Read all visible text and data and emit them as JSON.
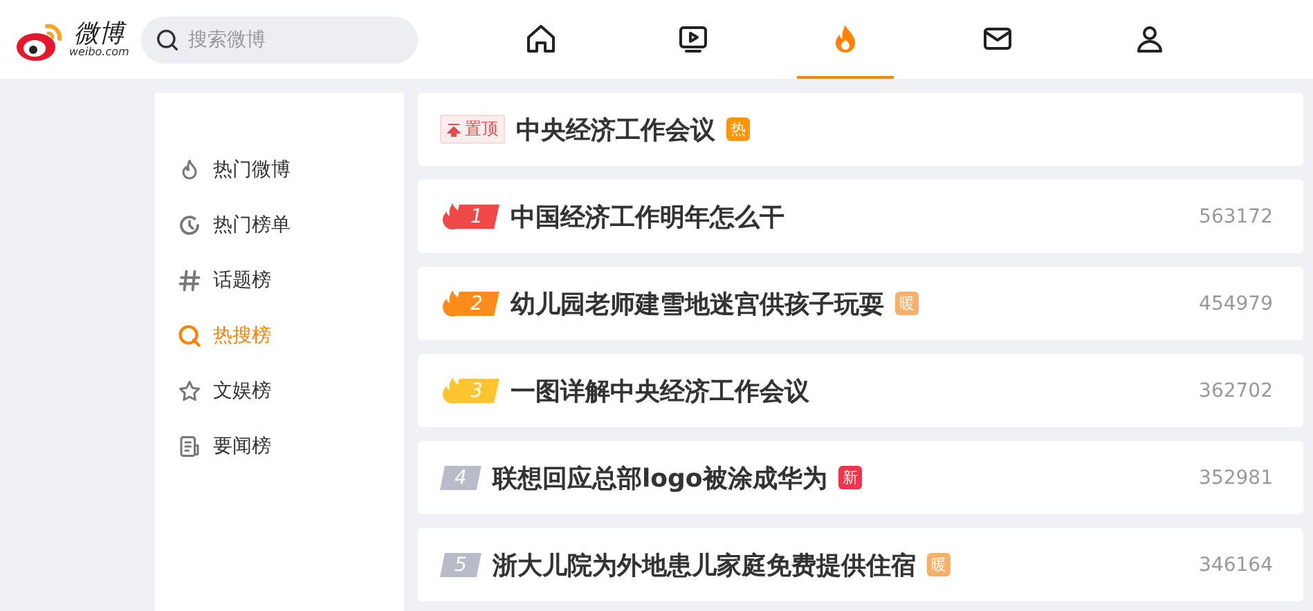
{
  "logo": {
    "name": "微博",
    "domain": "weibo.com"
  },
  "search": {
    "placeholder": "搜索微博"
  },
  "nav": [
    {
      "selected": false
    },
    {
      "selected": false
    },
    {
      "selected": true
    },
    {
      "selected": false
    },
    {
      "selected": false
    }
  ],
  "sidebar": {
    "items": [
      {
        "label": "热门微博",
        "selected": false
      },
      {
        "label": "热门榜单",
        "selected": false
      },
      {
        "label": "话题榜",
        "selected": false
      },
      {
        "label": "热搜榜",
        "selected": true
      },
      {
        "label": "文娱榜",
        "selected": false
      },
      {
        "label": "要闻榜",
        "selected": false
      }
    ]
  },
  "list": [
    {
      "kind": "pinned",
      "pin": "置顶",
      "title": "中央经济工作会议",
      "badge": {
        "text": "热",
        "color": "#ff9406"
      }
    },
    {
      "kind": "top",
      "rank": "1",
      "color": "#f04848",
      "title": "中国经济工作明年怎么干",
      "count": "563172"
    },
    {
      "kind": "top",
      "rank": "2",
      "color": "#ff8c1a",
      "title": "幼儿园老师建雪地迷宫供孩子玩耍",
      "count": "454979",
      "badge": {
        "text": "暖",
        "color": "#f7b06a"
      }
    },
    {
      "kind": "top",
      "rank": "3",
      "color": "#ffc42e",
      "title": "一图详解中央经济工作会议",
      "count": "362702"
    },
    {
      "kind": "normal",
      "rank": "4",
      "color": "#b8bcc8",
      "title": "联想回应总部logo被涂成华为",
      "count": "352981",
      "badge": {
        "text": "新",
        "color": "#f0324a"
      }
    },
    {
      "kind": "normal",
      "rank": "5",
      "color": "#b8bcc8",
      "title": "浙大儿院为外地患儿家庭免费提供住宿",
      "count": "346164",
      "badge": {
        "text": "暖",
        "color": "#f7b06a"
      }
    }
  ]
}
